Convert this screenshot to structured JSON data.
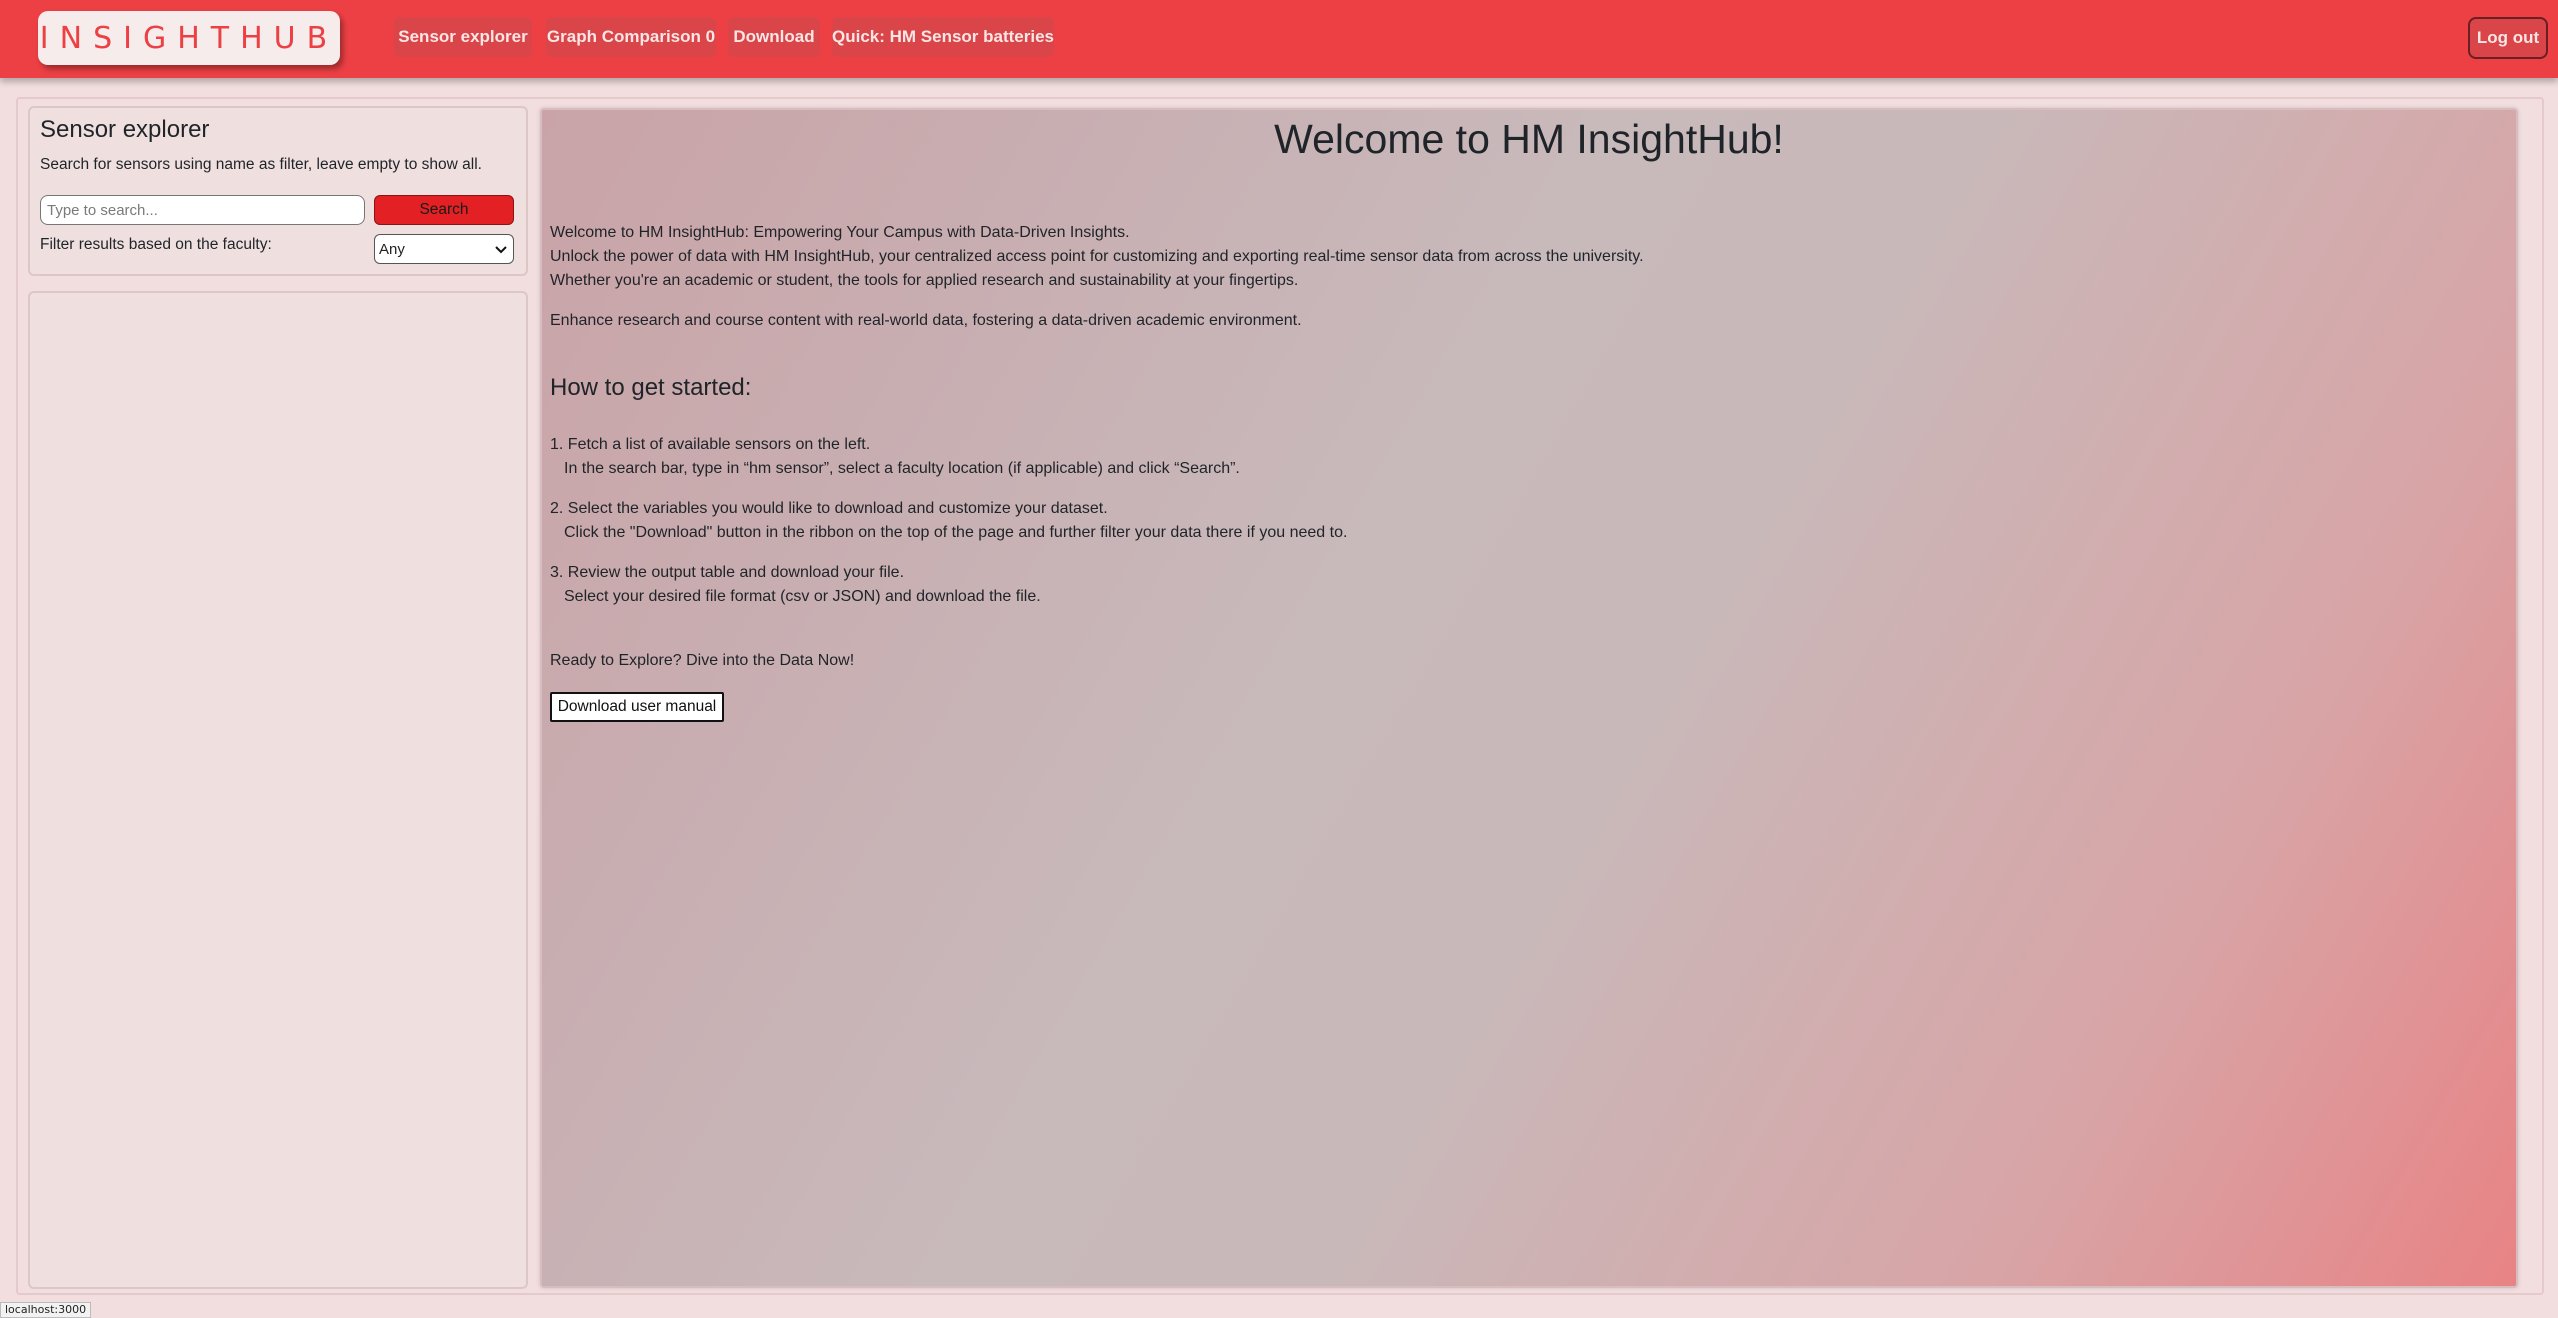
{
  "header": {
    "logo": "INSIGHTHUB",
    "nav": [
      "Sensor explorer",
      "Graph Comparison 0",
      "Download",
      "Quick: HM Sensor batteries"
    ],
    "logout_label": "Log out"
  },
  "sidebar": {
    "title": "Sensor explorer",
    "description": "Search for sensors using name as filter, leave empty to show all.",
    "search_placeholder": "Type to search...",
    "search_value": "",
    "search_button": "Search",
    "filter_label": "Filter results based on the faculty:",
    "filter_selected": "Any"
  },
  "main": {
    "title": "Welcome to HM InsightHub!",
    "intro": [
      "Welcome to HM InsightHub: Empowering Your Campus with Data-Driven Insights.",
      "Unlock the power of data with HM InsightHub, your centralized access point for customizing and exporting real-time sensor data from across the university.",
      "Whether you're an academic or student, the tools for applied research and sustainability at your fingertips."
    ],
    "enhance": "Enhance research and course content with real-world data, fostering a data-driven academic environment.",
    "how_title": "How to get started:",
    "steps": [
      {
        "title": "1. Fetch a list of available sensors on the left.",
        "detail": "In the search bar, type in “hm sensor”, select a faculty location (if applicable) and click “Search”."
      },
      {
        "title": "2. Select the variables you would like to download and customize your dataset.",
        "detail": "Click the \"Download\" button in the ribbon on the top of the page and further filter your data there if you need to."
      },
      {
        "title": "3. Review the output table and download your file.",
        "detail": "Select your desired file format (csv or JSON) and download the file."
      }
    ],
    "ready": "Ready to Explore? Dive into the Data Now!",
    "manual_button": "Download user manual"
  },
  "statusbar": {
    "url": "localhost:3000"
  },
  "colors": {
    "brand": "#ec4044",
    "button": "#e32024"
  }
}
